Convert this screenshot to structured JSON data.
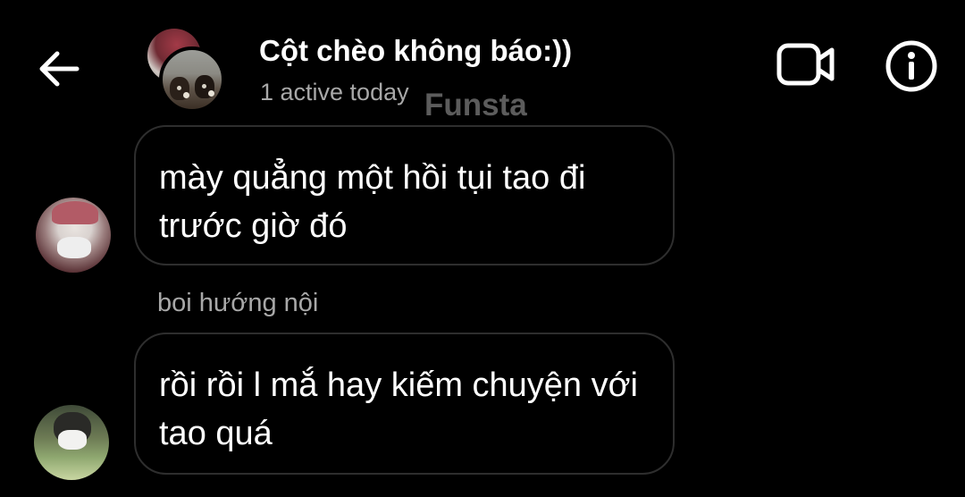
{
  "header": {
    "title": "Cột chèo không báo:))",
    "status": "1 active today",
    "back_icon": "arrow-left-icon",
    "video_icon": "video-camera-icon",
    "info_icon": "info-icon"
  },
  "watermark": "Funsta",
  "messages": [
    {
      "sender_name": "",
      "text": "mày quẳng một hồi tụi tao đi trước giờ đó"
    },
    {
      "sender_name": "boi hướng nội",
      "text": "rồi rồi l mắ hay kiếm chuyện với tao quá"
    }
  ],
  "colors": {
    "background": "#000000",
    "bubble_border": "#2e2e2e",
    "secondary_text": "#a8a8a8",
    "watermark": "#5c5c5c"
  }
}
